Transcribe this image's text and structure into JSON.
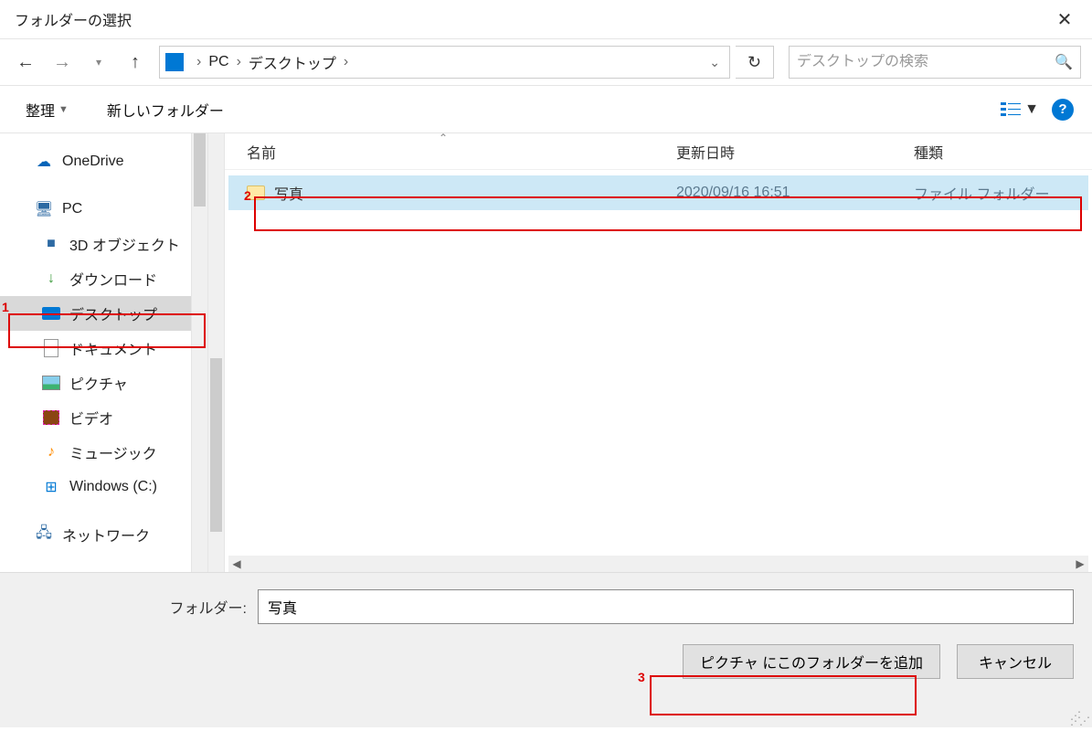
{
  "window": {
    "title": "フォルダーの選択"
  },
  "nav": {
    "breadcrumb": [
      "PC",
      "デスクトップ"
    ]
  },
  "search": {
    "placeholder": "デスクトップの検索"
  },
  "toolbar": {
    "organize": "整理",
    "new_folder": "新しいフォルダー"
  },
  "sidebar": {
    "onedrive": "OneDrive",
    "pc": "PC",
    "items": [
      "3D オブジェクト",
      "ダウンロード",
      "デスクトップ",
      "ドキュメント",
      "ピクチャ",
      "ビデオ",
      "ミュージック",
      "Windows (C:)"
    ],
    "network": "ネットワーク"
  },
  "columns": {
    "name": "名前",
    "date": "更新日時",
    "type": "種類"
  },
  "rows": [
    {
      "name": "写真",
      "date": "2020/09/16 16:51",
      "type": "ファイル フォルダー"
    }
  ],
  "bottom": {
    "label": "フォルダー:",
    "value": "写真",
    "primary": "ピクチャ にこのフォルダーを追加",
    "cancel": "キャンセル"
  },
  "annot": {
    "a1": "1",
    "a2": "2",
    "a3": "3"
  }
}
